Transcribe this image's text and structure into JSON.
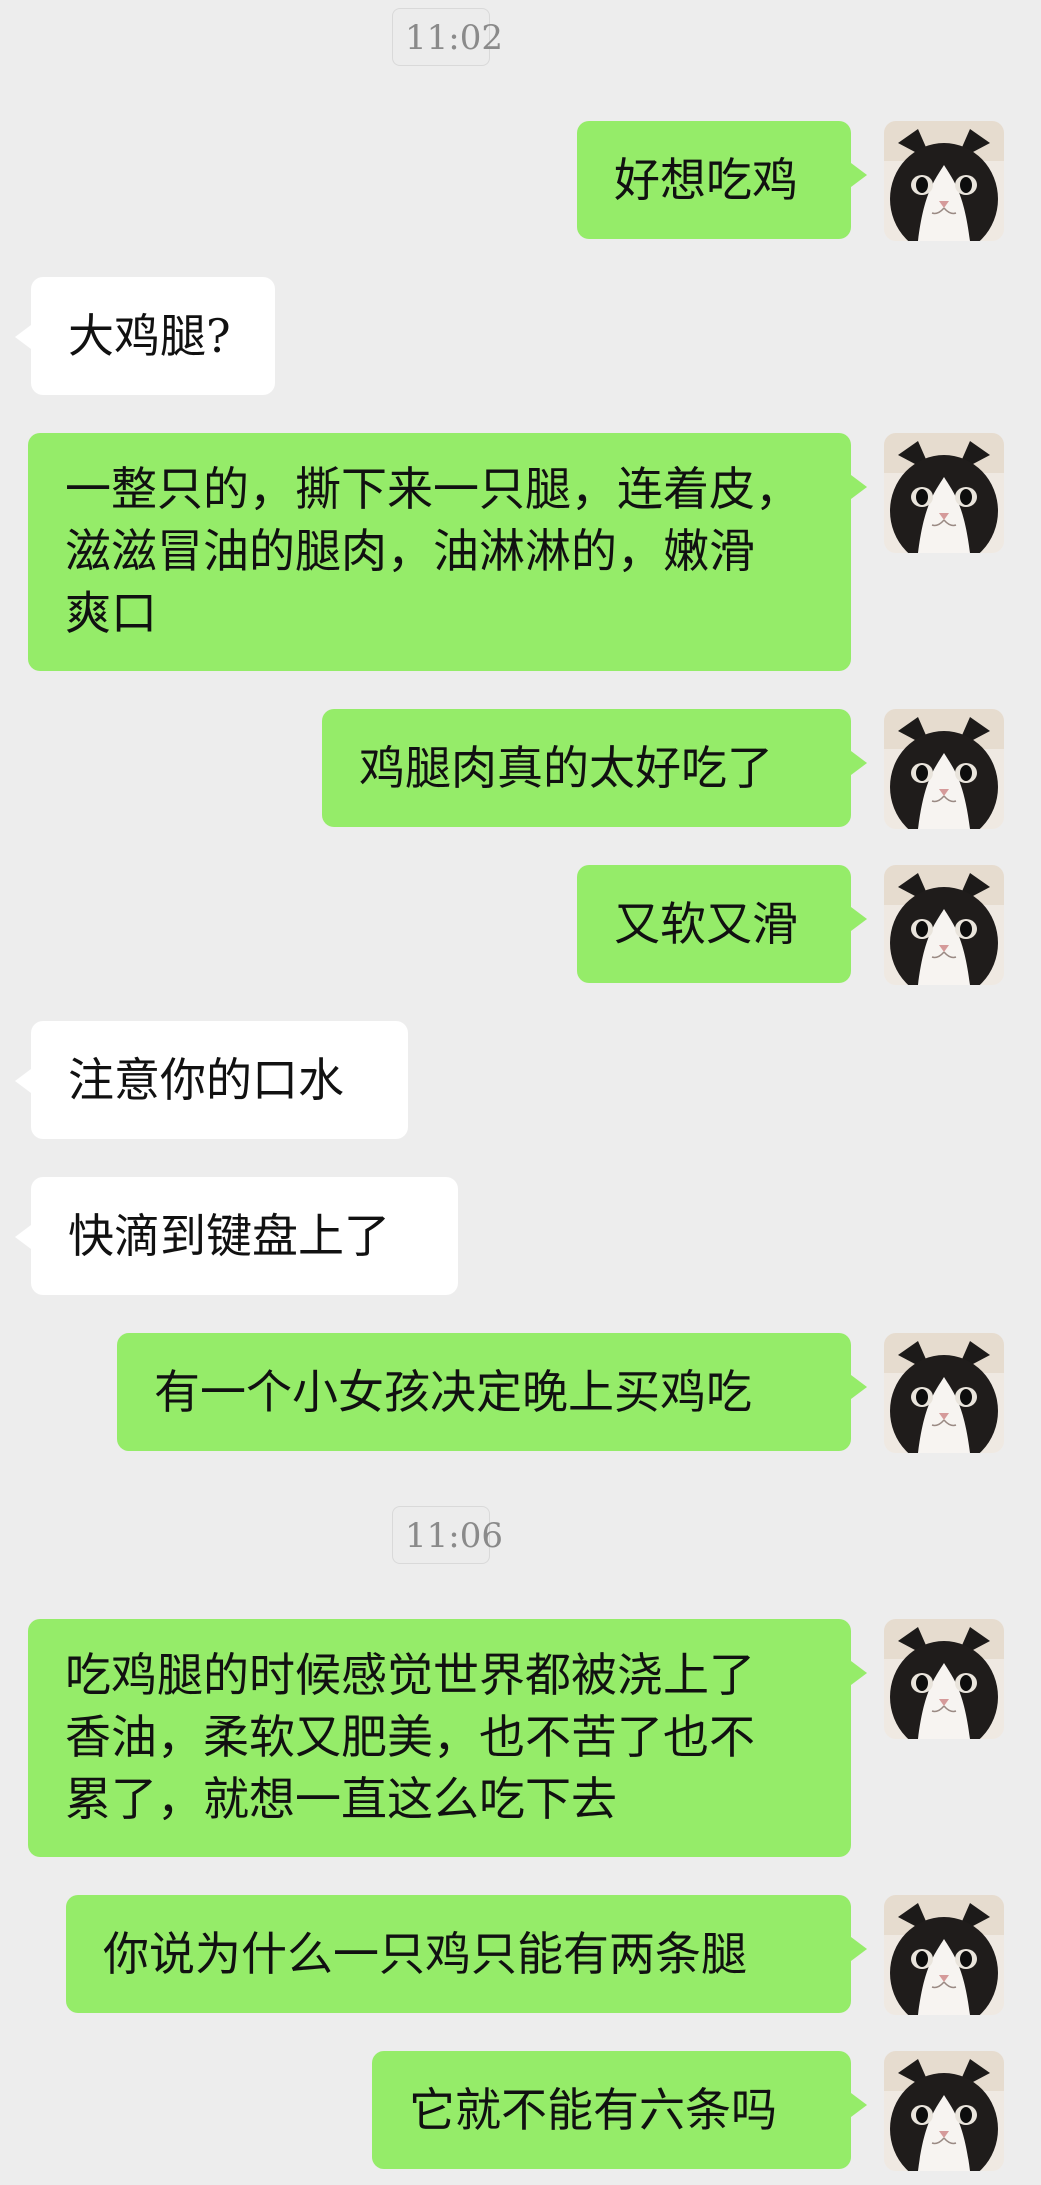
{
  "timestamps": [
    "11:02",
    "11:06"
  ],
  "messages": [
    {
      "side": "right",
      "text": "好想吃鸡"
    },
    {
      "side": "left",
      "text": "大鸡腿?"
    },
    {
      "side": "right",
      "text": "一整只的，撕下来一只腿，连着皮，\n滋滋冒油的腿肉，油淋淋的，嫩滑\n爽口"
    },
    {
      "side": "right",
      "text": "鸡腿肉真的太好吃了"
    },
    {
      "side": "right",
      "text": "又软又滑"
    },
    {
      "side": "left",
      "text": "注意你的口水"
    },
    {
      "side": "left",
      "text": "快滴到键盘上了"
    },
    {
      "side": "right",
      "text": "有一个小女孩决定晚上买鸡吃"
    },
    {
      "side": "right",
      "text": "吃鸡腿的时候感觉世界都被浇上了\n香油，柔软又肥美，也不苦了也不\n累了，就想一直这么吃下去"
    },
    {
      "side": "right",
      "text": "你说为什么一只鸡只能有两条腿"
    },
    {
      "side": "right",
      "text": "它就不能有六条吗"
    }
  ],
  "colors": {
    "background": "#ededed",
    "my_bubble": "#95ec69",
    "their_bubble": "#ffffff"
  },
  "avatar_icon": "cat-avatar-icon"
}
